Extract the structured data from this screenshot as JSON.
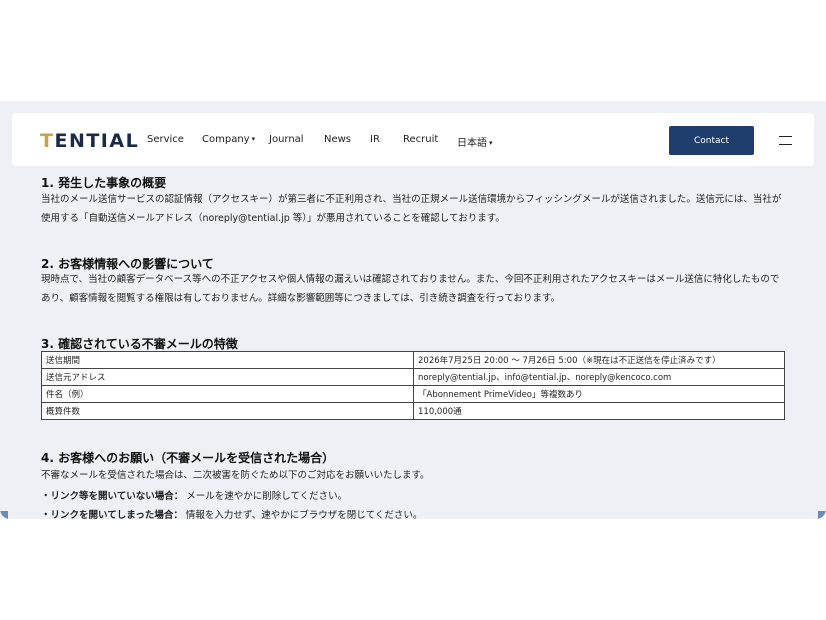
{
  "header": {
    "logo": "TENTIAL",
    "nav": [
      {
        "label": "Service"
      },
      {
        "label": "Company",
        "caret": "▾"
      },
      {
        "label": "Journal"
      },
      {
        "label": "News"
      },
      {
        "label": "IR"
      },
      {
        "label": "Recruit"
      },
      {
        "label": "日本語",
        "caret": "▾"
      }
    ],
    "contact_label": "Contact"
  },
  "sections": [
    {
      "heading": "1. 発生した事象の概要",
      "body": "当社のメール送信サービスの認証情報（アクセスキー）が第三者に不正利用され、当社の正規メール送信環境からフィッシングメールが送信されました。送信元には、当社が使用する「自動送信メールアドレス（noreply@tential.jp 等）」が悪用されていることを確認しております。"
    },
    {
      "heading": "2. お客様情報への影響について",
      "body": "現時点で、当社の顧客データベース等への不正アクセスや個人情報の漏えいは確認されておりません。また、今回不正利用されたアクセスキーはメール送信に特化したものであり、顧客情報を閲覧する権限は有しておりません。詳細な影響範囲等につきましては、引き続き調査を行っております。"
    },
    {
      "heading": "3. 確認されている不審メールの特徴"
    },
    {
      "heading": "4. お客様へのお願い（不審メールを受信された場合）",
      "body": "不審なメールを受信された場合は、二次被害を防ぐため以下のご対応をお願いいたします。"
    }
  ],
  "table": [
    {
      "key": "送信期間",
      "value": "2026年7月25日 20:00 〜 7月26日 5:00（※現在は不正送信を停止済みです）"
    },
    {
      "key": "送信元アドレス",
      "value": "noreply@tential.jp、info@tential.jp、noreply@kencoco.com"
    },
    {
      "key": "件名（例）",
      "value": "「Abonnement PrimeVideo」等複数あり"
    },
    {
      "key": "概算件数",
      "value": "110,000通"
    }
  ],
  "bullets": [
    {
      "label": "・リンク等を開いていない場合：",
      "text": " メールを速やかに削除してください。"
    },
    {
      "label": "・リンクを開いてしまった場合：",
      "text": " 情報を入力せず、速やかにブラウザを閉じてください。"
    }
  ]
}
